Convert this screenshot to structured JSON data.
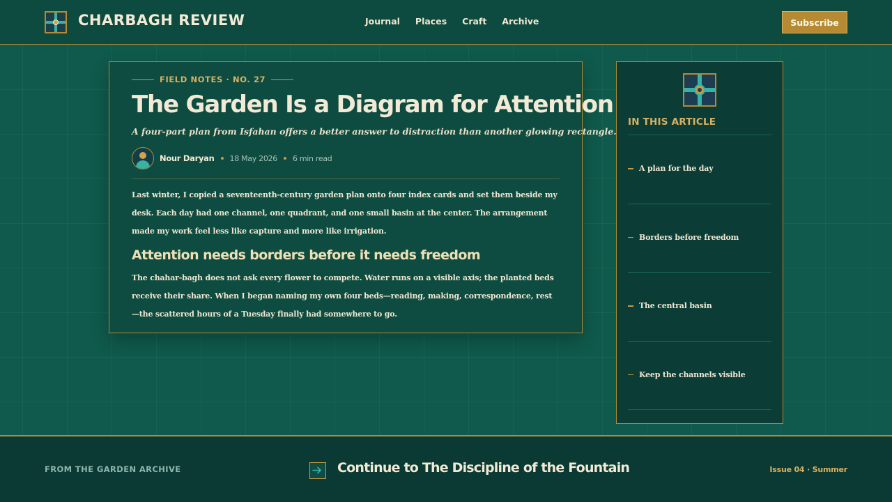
{
  "header": {
    "brand_name": "CHARBAGH REVIEW",
    "nav": [
      {
        "label": "Journal"
      },
      {
        "label": "Places"
      },
      {
        "label": "Craft"
      },
      {
        "label": "Archive"
      }
    ],
    "subscribe_label": "Subscribe"
  },
  "article": {
    "kicker": "FIELD NOTES · NO. 27",
    "title": "The Garden Is a Diagram for Attention",
    "dek": "A four-part plan from Isfahan offers a better answer to distraction than another glowing rectangle.",
    "author": "Nour Daryan",
    "date": "18 May 2026",
    "read_time": "6 min read",
    "paragraph1": "Last winter, I copied a seventeenth-century garden plan onto four index cards and set them beside my desk. Each day had one channel, one quadrant, and one small basin at the center. The arrangement made my work feel less like capture and more like irrigation.",
    "subhead": "Attention needs borders before it needs freedom",
    "paragraph2": "The chahar-bagh does not ask every flower to compete. Water runs on a visible axis; the planted beds receive their share. When I began naming my own four beds—reading, making, correspondence, rest—the scattered hours of a Tuesday finally had somewhere to go."
  },
  "sidebar": {
    "heading": "IN THIS ARTICLE",
    "items": [
      {
        "label": "A plan for the day"
      },
      {
        "label": "Borders before freedom"
      },
      {
        "label": "The central basin"
      },
      {
        "label": "Keep the channels visible"
      }
    ]
  },
  "footer": {
    "left_label": "FROM THE GARDEN ARCHIVE",
    "continue_label": "Continue to The Discipline of the Fountain",
    "issue": "Issue 04 · Summer"
  },
  "colors": {
    "background": "#0f5a4c",
    "panel": "#0e4c41",
    "gold": "#b58a33",
    "teal_accent": "#36b3a5",
    "cream_text": "#f3ead6"
  },
  "icons": {
    "brand": "garden-quadrant-icon",
    "sidebar": "garden-quadrant-icon",
    "author": "avatar-person-icon",
    "continue": "arrow-right-into-box-icon"
  }
}
